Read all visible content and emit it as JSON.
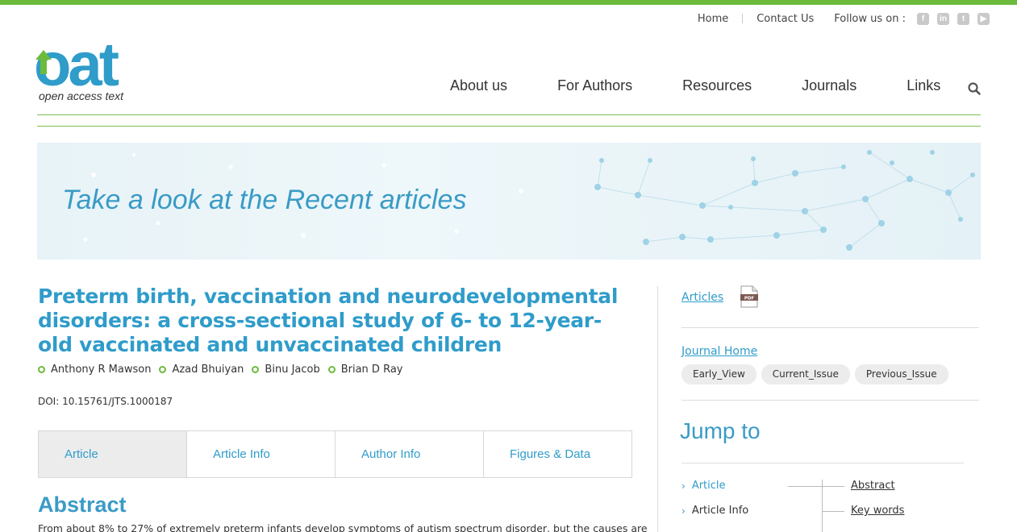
{
  "colors": {
    "accent_green": "#6cbb3c",
    "accent_blue": "#2f9cca",
    "heading_blue": "#3a9bc6"
  },
  "utility_nav": {
    "home": "Home",
    "contact": "Contact Us",
    "follow": "Follow us on :",
    "social": [
      "facebook-icon",
      "linkedin-icon",
      "twitter-icon",
      "youtube-icon"
    ]
  },
  "logo": {
    "wordmark": "oat",
    "tagline": "open access text"
  },
  "main_nav": [
    "About us",
    "For Authors",
    "Resources",
    "Journals",
    "Links"
  ],
  "banner": {
    "text": "Take a look at the Recent articles"
  },
  "article": {
    "title": "Preterm birth, vaccination and neurodevelopmental disorders: a cross-sectional study of 6- to 12-year-old vaccinated and unvaccinated children",
    "authors": [
      "Anthony R Mawson",
      "Azad Bhuiyan",
      "Binu Jacob",
      "Brian D Ray"
    ],
    "doi": "DOI: 10.15761/JTS.1000187",
    "tabs": [
      "Article",
      "Article Info",
      "Author Info",
      "Figures & Data"
    ],
    "active_tab": "Article",
    "abstract_heading": "Abstract",
    "abstract_start": "From about 8% to 27% of extremely preterm infants develop symptoms of autism spectrum disorder, but the causes are"
  },
  "sidebar": {
    "articles": "Articles",
    "pdf_label": "PDF",
    "journal_home": "Journal Home",
    "pills": [
      "Early_View",
      "Current_Issue",
      "Previous_Issue"
    ],
    "jump_to": "Jump to",
    "jump_left": [
      "Article",
      "Article Info"
    ],
    "jump_right": [
      "Abstract",
      "Key words"
    ]
  }
}
